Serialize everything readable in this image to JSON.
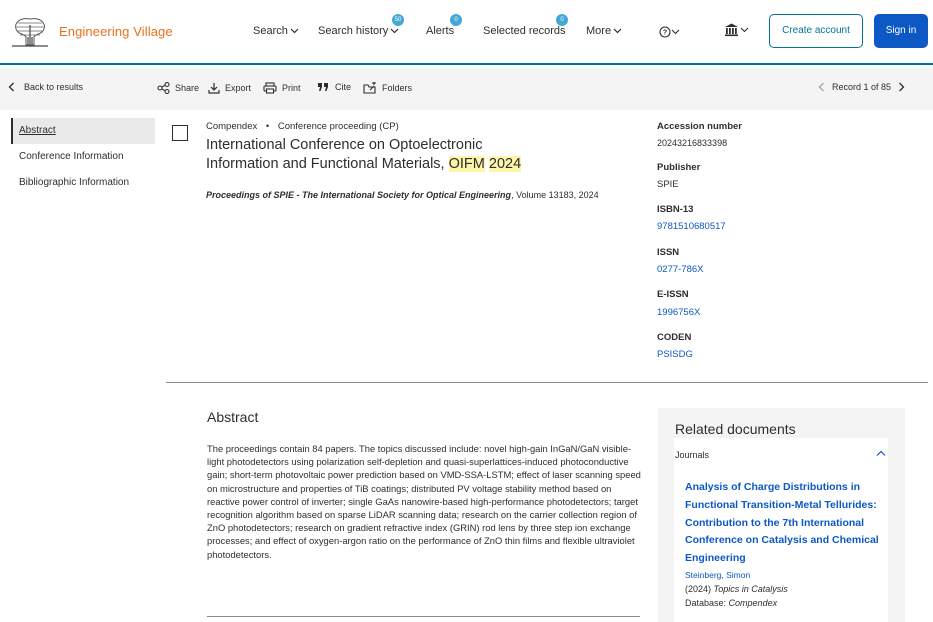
{
  "header": {
    "brand": "Engineering Village",
    "nav": [
      {
        "label": "Search",
        "badge": ""
      },
      {
        "label": "Search history",
        "badge": "50"
      },
      {
        "label": "Alerts",
        "badge": "0"
      },
      {
        "label": "Selected records",
        "badge": "0"
      },
      {
        "label": "More",
        "badge": ""
      }
    ],
    "create_account": "Create account",
    "sign_in": "Sign in",
    "help_icon": "question-circle-icon",
    "institution_icon": "institution-icon"
  },
  "toolbar": {
    "back": "Back to results",
    "share": "Share",
    "export": "Export",
    "print": "Print",
    "cite": "Cite",
    "folders": "Folders",
    "record_position": "Record 1 of 85"
  },
  "leftnav": {
    "items": [
      "Abstract",
      "Conference Information",
      "Bibliographic Information"
    ]
  },
  "record": {
    "database": "Compendex",
    "doc_type": "Conference proceeding (CP)",
    "title_line1": "International Conference on Optoelectronic",
    "title_line2": "Information and Functional Materials,",
    "title_hl1": "OIFM",
    "title_hl2": "2024",
    "proceedings_title": "Proceedings of SPIE - The International Society for Optical Engineering",
    "proceedings_rest": ", Volume 13183, 2024"
  },
  "metadata": {
    "accession_label": "Accession number",
    "accession_value": "20243216833398",
    "publisher_label": "Publisher",
    "publisher_value": "SPIE",
    "isbn_label": "ISBN-13",
    "isbn_value": "9781510680517",
    "issn_label": "ISSN",
    "issn_value": "0277-786X",
    "eissn_label": "E-ISSN",
    "eissn_value": "1996756X",
    "coden_label": "CODEN",
    "coden_value": "PSISDG"
  },
  "abstract": {
    "heading": "Abstract",
    "text": "The proceedings contain 84 papers. The topics discussed include: novel high-gain InGaN/GaN visible-light photodetectors using polarization self-depletion and quasi-superlattices-induced photoconductive gain; short-term photovoltaic power prediction based on VMD-SSA-LSTM; effect of laser scanning speed on microstructure and properties of TiB coatings; distributed PV voltage stability method based on reactive power control of inverter; single GaAs nanowire-based high-performance photodetectors; target recognition algorithm based on sparse LiDAR scanning data; research on the carrier collection region of ZnO photodetectors; research on gradient refractive index (GRIN) rod lens by three step ion exchange processes; and effect of oxygen-argon ratio on the performance of ZnO thin films and flexible ultraviolet photodetectors."
  },
  "related": {
    "heading": "Related documents",
    "tab": "Journals",
    "doc_title": "Analysis of Charge Distributions in Functional Transition-Metal Tellurides: Contribution to the 7th International Conference on Catalysis and Chemical Engineering",
    "author": "Steinberg, Simon",
    "source_year": "(2024)",
    "source_title": "Topics in Catalysis",
    "db_label": "Database:",
    "db_value": "Compendex"
  }
}
